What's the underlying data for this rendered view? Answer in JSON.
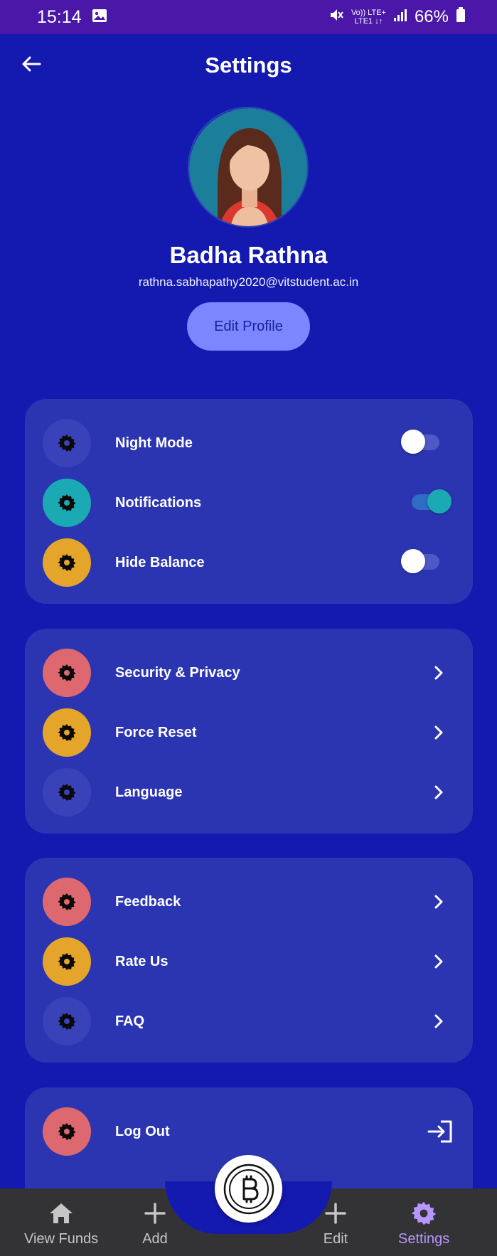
{
  "status_bar": {
    "time": "15:14",
    "network_top": "Vo)) LTE+",
    "network_bottom": "LTE1 ↓↑",
    "battery": "66%"
  },
  "header": {
    "title": "Settings"
  },
  "profile": {
    "name": "Badha Rathna",
    "email": "rathna.sabhapathy2020@vitstudent.ac.in",
    "edit_label": "Edit Profile"
  },
  "colors": {
    "background": "#1419b0",
    "card": "#2b35b2",
    "accent_teal": "#1ba9b4",
    "accent_orange": "#e5a52a",
    "accent_red": "#de6870",
    "accent_indigo": "#3a42ba"
  },
  "toggles_card": {
    "items": [
      {
        "label": "Night Mode",
        "icon": "gear-icon",
        "enabled": false
      },
      {
        "label": "Notifications",
        "icon": "gear-icon",
        "enabled": true
      },
      {
        "label": "Hide Balance",
        "icon": "gear-icon",
        "enabled": false
      }
    ]
  },
  "account_card": {
    "items": [
      {
        "label": "Security & Privacy",
        "icon": "gear-icon"
      },
      {
        "label": "Force Reset",
        "icon": "gear-icon"
      },
      {
        "label": "Language",
        "icon": "gear-icon"
      }
    ]
  },
  "support_card": {
    "items": [
      {
        "label": "Feedback",
        "icon": "gear-icon"
      },
      {
        "label": "Rate Us",
        "icon": "gear-icon"
      },
      {
        "label": "FAQ",
        "icon": "gear-icon"
      }
    ]
  },
  "logout_card": {
    "label": "Log Out",
    "icon": "logout-icon"
  },
  "bottom_nav": {
    "items": [
      {
        "label": "View Funds",
        "icon": "home-icon"
      },
      {
        "label": "Add",
        "icon": "plus-icon"
      },
      {
        "label": "Edit",
        "icon": "plus-icon"
      },
      {
        "label": "Settings",
        "icon": "gear-icon",
        "active": true
      }
    ],
    "center_icon": "bitcoin-icon"
  }
}
